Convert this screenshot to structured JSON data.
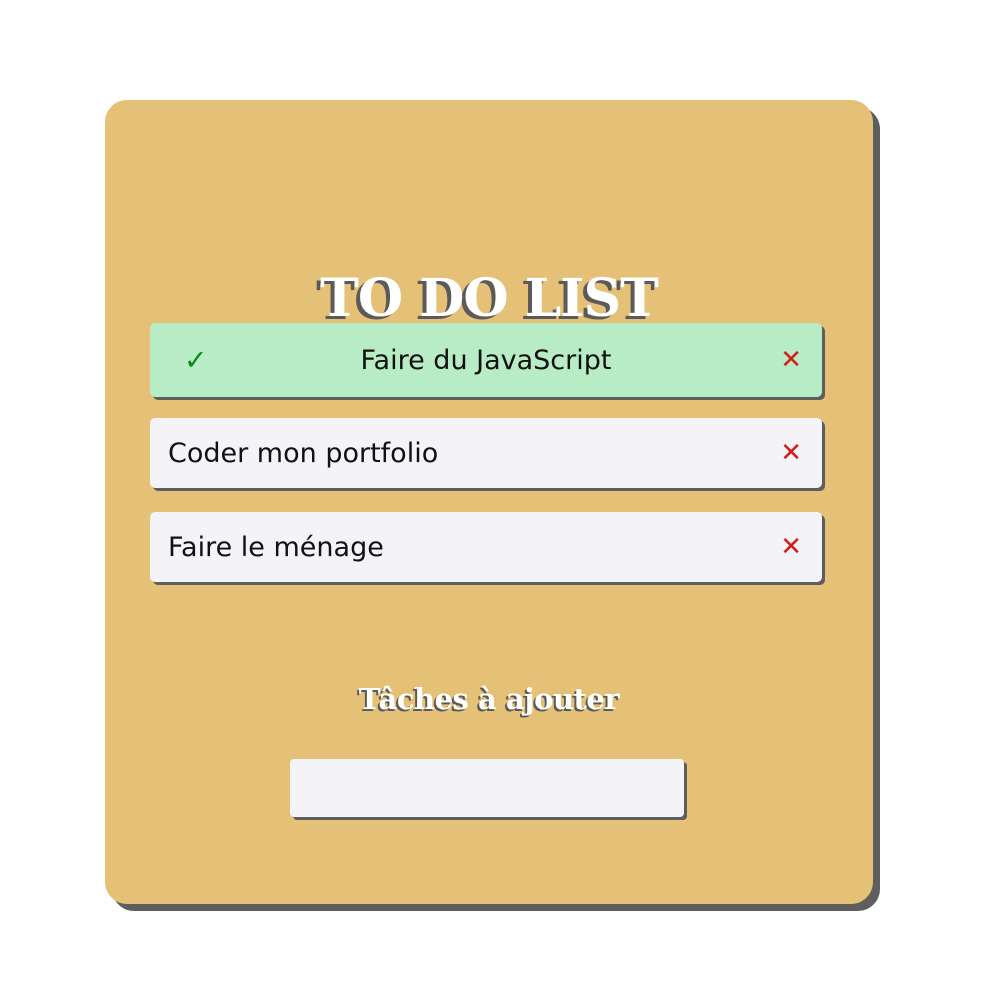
{
  "app": {
    "title": "TO DO LIST"
  },
  "tasks": [
    {
      "label": "Faire du JavaScript",
      "done": true,
      "check_icon": "✓",
      "delete_icon": "✕"
    },
    {
      "label": "Coder mon portfolio",
      "done": false,
      "delete_icon": "✕"
    },
    {
      "label": "Faire le ménage",
      "done": false,
      "delete_icon": "✕"
    }
  ],
  "add_section": {
    "heading": "Tâches à ajouter",
    "input_value": "",
    "input_placeholder": ""
  },
  "colors": {
    "card_background": "#e5c177",
    "done_task_background": "#b8ecc4",
    "task_background": "#f4f4f8",
    "check_color": "#0a8a1a",
    "delete_color": "#d41c1c",
    "shadow": "#5e5e5e"
  }
}
